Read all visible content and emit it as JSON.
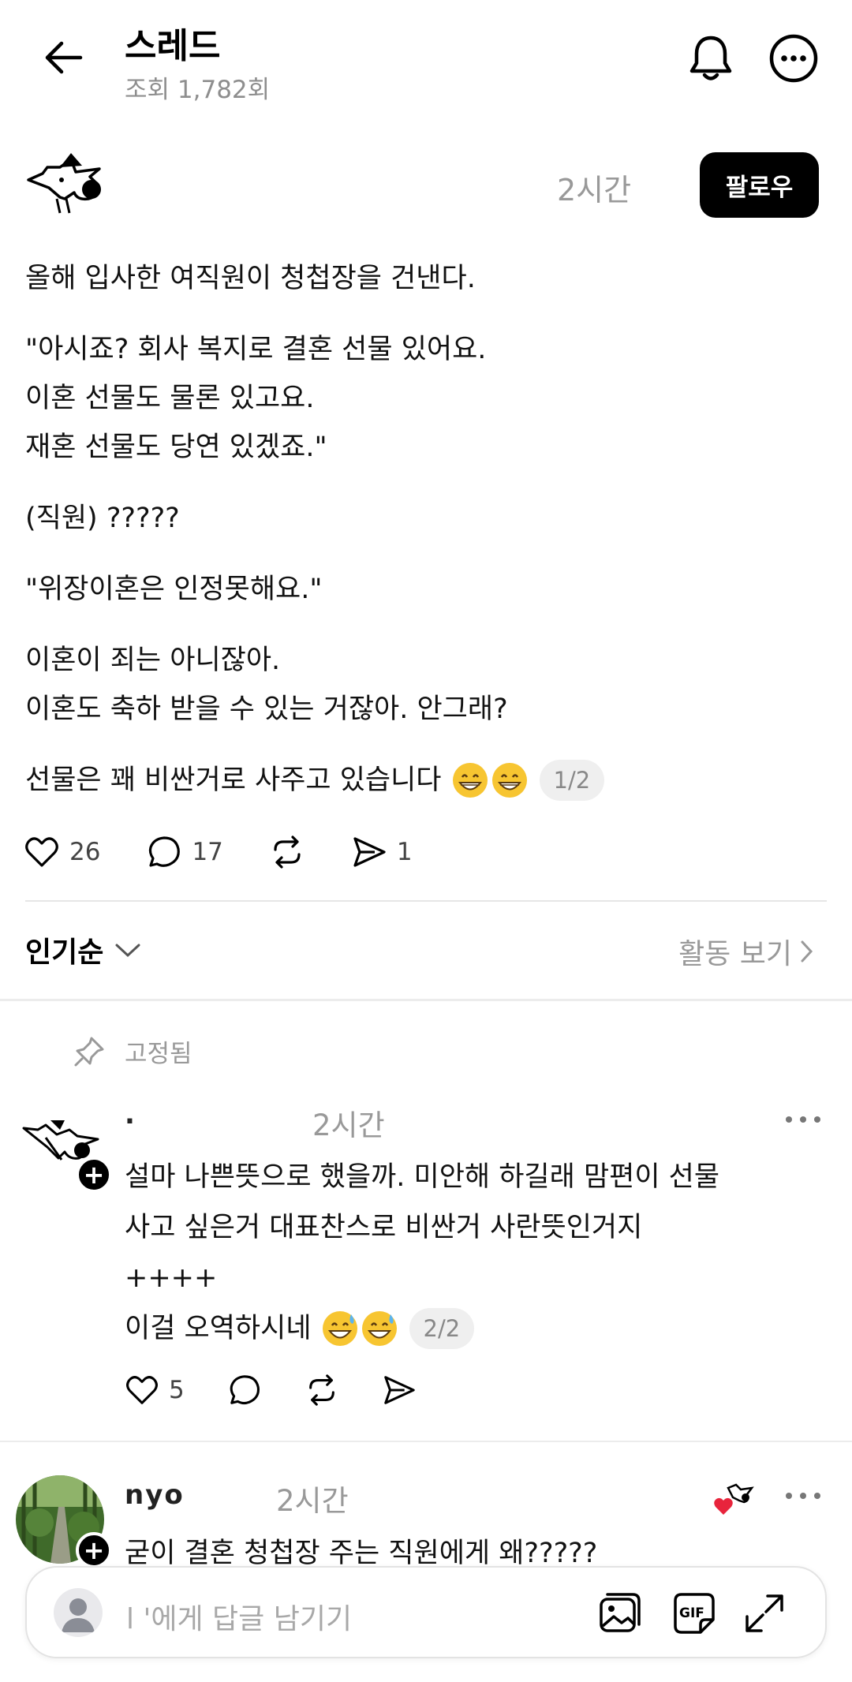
{
  "header": {
    "title": "스레드",
    "views": "조회 1,782회"
  },
  "post": {
    "time": "2시간",
    "follow_label": "팔로우",
    "paragraphs": [
      "올해 입사한 여직원이 청첩장을 건낸다.",
      "\"아시죠? 회사 복지로 결혼 선물 있어요.\n이혼 선물도 물론 있고요.\n재혼 선물도 당연 있겠죠.\"",
      "(직원) ?????",
      "\"위장이혼은 인정못해요.\"",
      "이혼이 죄는 아니잖아.\n이혼도 축하 받을 수 있는 거잖아. 안그래?"
    ],
    "last_line": "선물은  꽤 비싼거로 사주고 있습니다",
    "emoji": [
      "grinning-face-emoji",
      "grinning-face-emoji"
    ],
    "page_indicator": "1/2",
    "likes": "26",
    "comments": "17",
    "shares": "1"
  },
  "sort": {
    "label": "인기순",
    "activity_label": "활동 보기"
  },
  "pinned_comment": {
    "pinned_label": "고정됨",
    "time": "2시간",
    "lines": [
      "설마 나쁜뜻으로 했을까. 미안해 하길래 맘편이 선물",
      "사고 싶은거 대표찬스로 비싼거 사란뜻인거지",
      "++++"
    ],
    "last_line": "이걸 오역하시네",
    "emoji": [
      "sweat-smile-emoji",
      "sweat-smile-emoji"
    ],
    "page_indicator": "2/2",
    "likes": "5"
  },
  "second_comment": {
    "username": "nyo",
    "time": "2시간",
    "text": "굳이 결혼 청첩장 주는 직원에게 왜?????"
  },
  "reply_bar": {
    "placeholder": "l                    '에게 답글 남기기"
  },
  "colors": {
    "accent": "#000000",
    "muted": "#999999",
    "heart": "#e8243c",
    "emoji": "#f7c531"
  }
}
